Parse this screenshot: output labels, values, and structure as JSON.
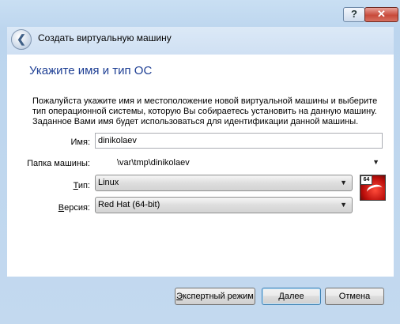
{
  "window": {
    "help_label": "?",
    "close_label": "✕"
  },
  "wizard": {
    "title": "Создать виртуальную машину",
    "back_label": "❮"
  },
  "section": {
    "title": "Укажите имя и тип ОС",
    "description": "Пожалуйста укажите имя и местоположение новой виртуальной машины и выберите тип операционной системы, которую Вы собираетесь установить на данную машину. Заданное Вами имя будет использоваться для идентификации данной машины."
  },
  "form": {
    "name": {
      "label": "Имя:",
      "value": "dinikolaev"
    },
    "folder": {
      "label": "Папка машины:",
      "value": "\\var\\tmp\\dinikolaev"
    },
    "type": {
      "label_accel": "Т",
      "label_rest": "ип:",
      "value": "Linux"
    },
    "version": {
      "label_accel": "В",
      "label_rest": "ерсия:",
      "value": "Red Hat (64-bit)"
    },
    "os_badge": "64"
  },
  "buttons": {
    "expert_accel": "Э",
    "expert_rest": "кспертный режим",
    "next_accel": "Д",
    "next_rest": "алее",
    "cancel": "Отмена"
  }
}
